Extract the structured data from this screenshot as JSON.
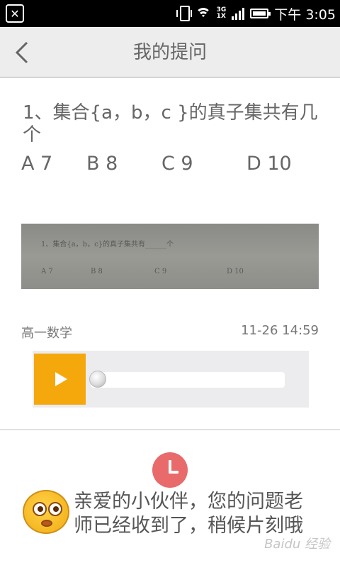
{
  "status_bar": {
    "time": "下午 3:05",
    "network_top": "3G",
    "network_bottom": "1X"
  },
  "header": {
    "title": "我的提问"
  },
  "question": {
    "text": "1、集合{a，b，c }的真子集共有几个",
    "options": [
      "A 7",
      "B 8",
      "C 9",
      "D 10"
    ]
  },
  "photo": {
    "line1": "1、集合{a，b，c}的真子集共有______个",
    "opts": [
      "A 7",
      "B 8",
      "C 9",
      "D 10"
    ]
  },
  "meta": {
    "subject": "高一数学",
    "time": "11-26 14:59"
  },
  "audio": {
    "progress": 0
  },
  "notice": {
    "text": "亲爱的小伙伴，您的问题老师已经收到了，稍候片刻哦"
  },
  "watermark": "Baidu 经验",
  "colors": {
    "play_button": "#f5a80c",
    "status_icon": "#e86a6a",
    "header_bg": "#ededed"
  }
}
